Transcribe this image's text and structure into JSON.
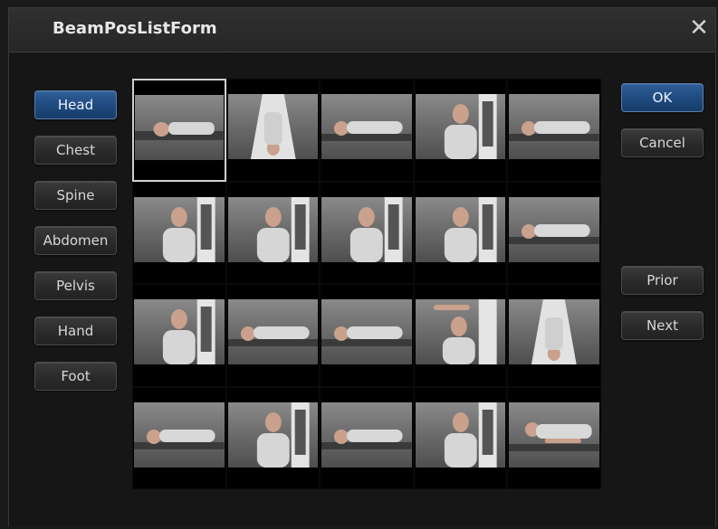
{
  "window": {
    "title": "BeamPosListForm",
    "close_icon": "close-icon"
  },
  "body_parts": [
    {
      "label": "Head",
      "active": true
    },
    {
      "label": "Chest",
      "active": false
    },
    {
      "label": "Spine",
      "active": false
    },
    {
      "label": "Abdomen",
      "active": false
    },
    {
      "label": "Pelvis",
      "active": false
    },
    {
      "label": "Hand",
      "active": false
    },
    {
      "label": "Foot",
      "active": false
    }
  ],
  "actions": {
    "ok_label": "OK",
    "cancel_label": "Cancel",
    "prior_label": "Prior",
    "next_label": "Next"
  },
  "grid": {
    "rows": 4,
    "cols": 5,
    "selected_index": 0,
    "thumbnails": [
      "patient-supine-lateral",
      "patient-supine-top",
      "patient-supine-side",
      "patient-standing-board",
      "patient-supine-side",
      "patient-standing-board",
      "patient-standing-board",
      "patient-standing-board",
      "patient-standing-board",
      "patient-supine-side",
      "patient-standing-board",
      "patient-supine-side",
      "patient-supine-side",
      "patient-standing-arm-raised",
      "patient-supine-top",
      "patient-supine-side",
      "patient-standing-board",
      "patient-supine-side",
      "patient-standing-board",
      "patient-prone-side"
    ]
  },
  "colors": {
    "active_button": "#1f4a7e",
    "background": "#161616",
    "grid": "#000000"
  }
}
